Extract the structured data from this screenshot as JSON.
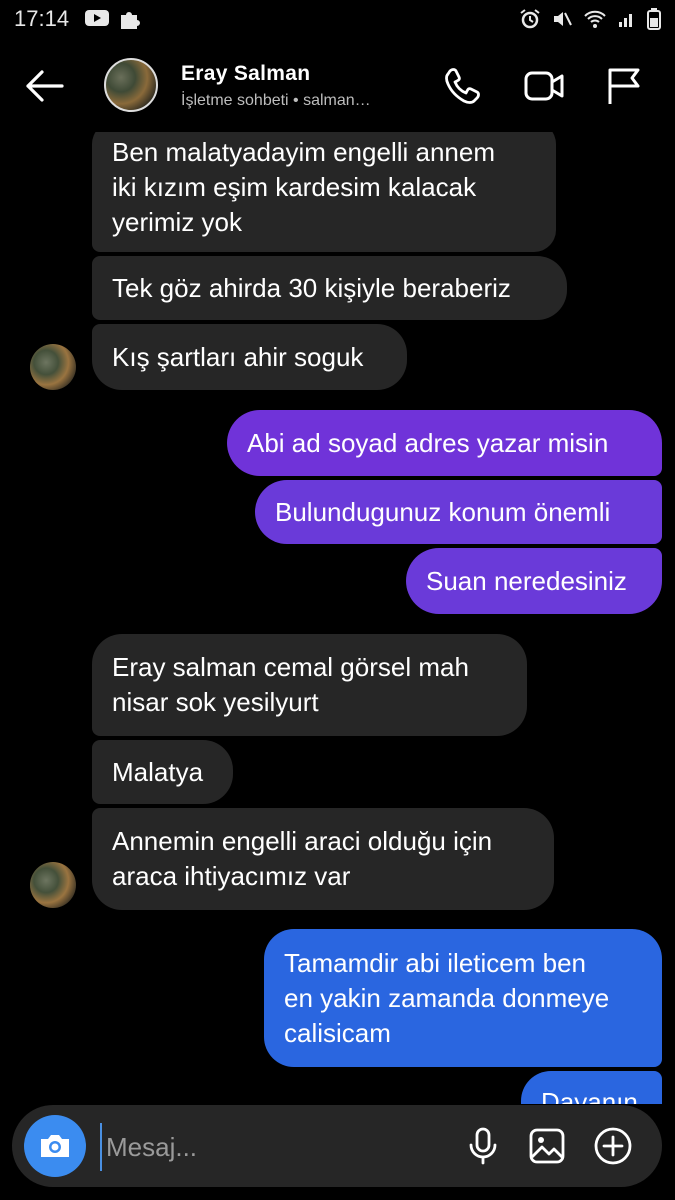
{
  "status_bar": {
    "time": "17:14"
  },
  "header": {
    "name": "Eray  Salman",
    "subtitle": "İşletme sohbeti • salman…"
  },
  "messages": [
    {
      "side": "in",
      "text": "Ben malatyadayim engelli annem\niki kızım eşim kardesim kalacak\nyerimiz yok"
    },
    {
      "side": "in",
      "text": "Tek göz ahirda 30 kişiyle beraberiz"
    },
    {
      "side": "in",
      "text": "Kış şartları ahir soguk"
    },
    {
      "side": "out",
      "text": "Abi ad soyad adres yazar misin"
    },
    {
      "side": "out",
      "text": "Bulundugunuz konum önemli"
    },
    {
      "side": "out",
      "text": "Suan neredesiniz"
    },
    {
      "side": "in",
      "text": "Eray salman cemal görsel mah\nnisar sok yesilyurt"
    },
    {
      "side": "in",
      "text": "Malatya"
    },
    {
      "side": "in",
      "text": "Annemin engelli araci olduğu için\naraca ihtiyacımız var"
    },
    {
      "side": "out",
      "text": "Tamamdir abi ileticem ben\nen yakin zamanda donmeye\ncalisicam"
    },
    {
      "side": "out",
      "text": "Dayanın"
    }
  ],
  "composer": {
    "placeholder": "Mesaj..."
  },
  "icons": {
    "back": "arrow-left-icon",
    "call": "phone-icon",
    "video": "video-camera-icon",
    "report": "flag-icon",
    "camera": "camera-icon",
    "mic": "microphone-icon",
    "gallery": "image-icon",
    "add": "plus-circle-icon"
  },
  "colors": {
    "incoming_bubble": "#262626",
    "outgoing_purple": "#7033d9",
    "outgoing_blue": "#2a66e0",
    "camera_button": "#3b8cf0"
  }
}
